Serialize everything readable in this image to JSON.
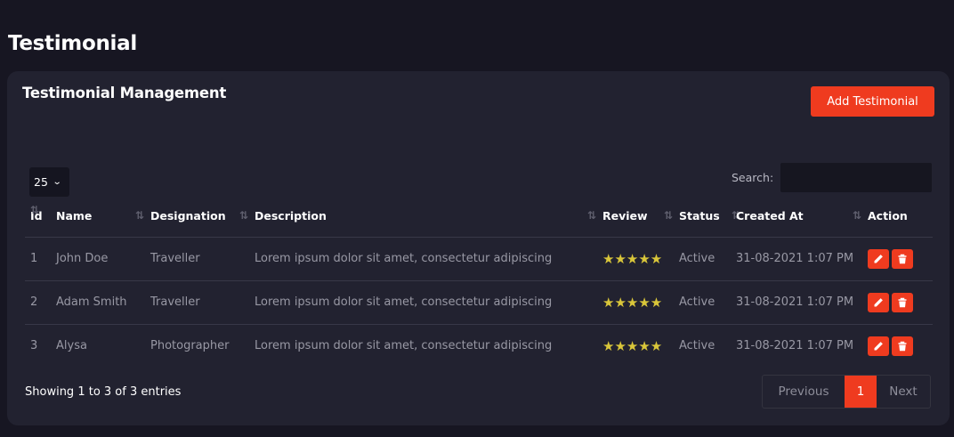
{
  "page": {
    "title": "Testimonial"
  },
  "card": {
    "title": "Testimonial Management",
    "add_button": "Add Testimonial"
  },
  "controls": {
    "length_value": "25",
    "search_label": "Search:",
    "search_value": ""
  },
  "table": {
    "columns": [
      "Id",
      "Name",
      "Designation",
      "Description",
      "Review",
      "Status",
      "Created At",
      "Action"
    ],
    "rows": [
      {
        "id": "1",
        "name": "John Doe",
        "designation": "Traveller",
        "description": "Lorem ipsum dolor sit amet, consectetur adipiscing",
        "review": "★★★★★",
        "status": "Active",
        "created_at": "31-08-2021 1:07 PM"
      },
      {
        "id": "2",
        "name": "Adam Smith",
        "designation": "Traveller",
        "description": "Lorem ipsum dolor sit amet, consectetur adipiscing",
        "review": "★★★★★",
        "status": "Active",
        "created_at": "31-08-2021 1:07 PM"
      },
      {
        "id": "3",
        "name": "Alysa",
        "designation": "Photographer",
        "description": "Lorem ipsum dolor sit amet, consectetur adipiscing",
        "review": "★★★★★",
        "status": "Active",
        "created_at": "31-08-2021 1:07 PM"
      }
    ],
    "action_icons": [
      "pencil-icon",
      "trash-icon"
    ]
  },
  "footer": {
    "info": "Showing 1 to 3 of 3 entries",
    "prev": "Previous",
    "current_page": "1",
    "next": "Next"
  },
  "colors": {
    "accent": "#ef3b1f",
    "background": "#171622",
    "card": "#222230",
    "star": "#d9c63a"
  }
}
